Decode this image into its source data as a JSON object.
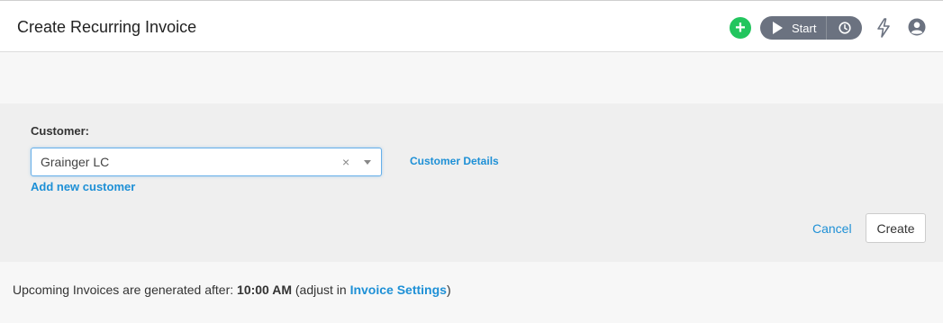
{
  "header": {
    "title": "Create Recurring Invoice",
    "start_label": "Start",
    "icons": [
      "plus-icon",
      "play-icon",
      "clock-icon",
      "bolt-icon",
      "user-icon"
    ],
    "colors": {
      "plus": "#22c55e",
      "timer": "#6b7280"
    }
  },
  "form": {
    "customer_label": "Customer:",
    "customer_value": "Grainger LC",
    "clear_symbol": "×",
    "customer_details_link": "Customer Details",
    "add_customer_link": "Add new customer",
    "cancel_label": "Cancel",
    "create_label": "Create"
  },
  "footer": {
    "prefix": "Upcoming Invoices are generated after: ",
    "time": "10:00 AM",
    "middle": " (adjust in ",
    "settings_link": "Invoice Settings",
    "suffix": ")"
  },
  "colors": {
    "link": "#1e90d6",
    "focus_border": "#66afe9"
  }
}
